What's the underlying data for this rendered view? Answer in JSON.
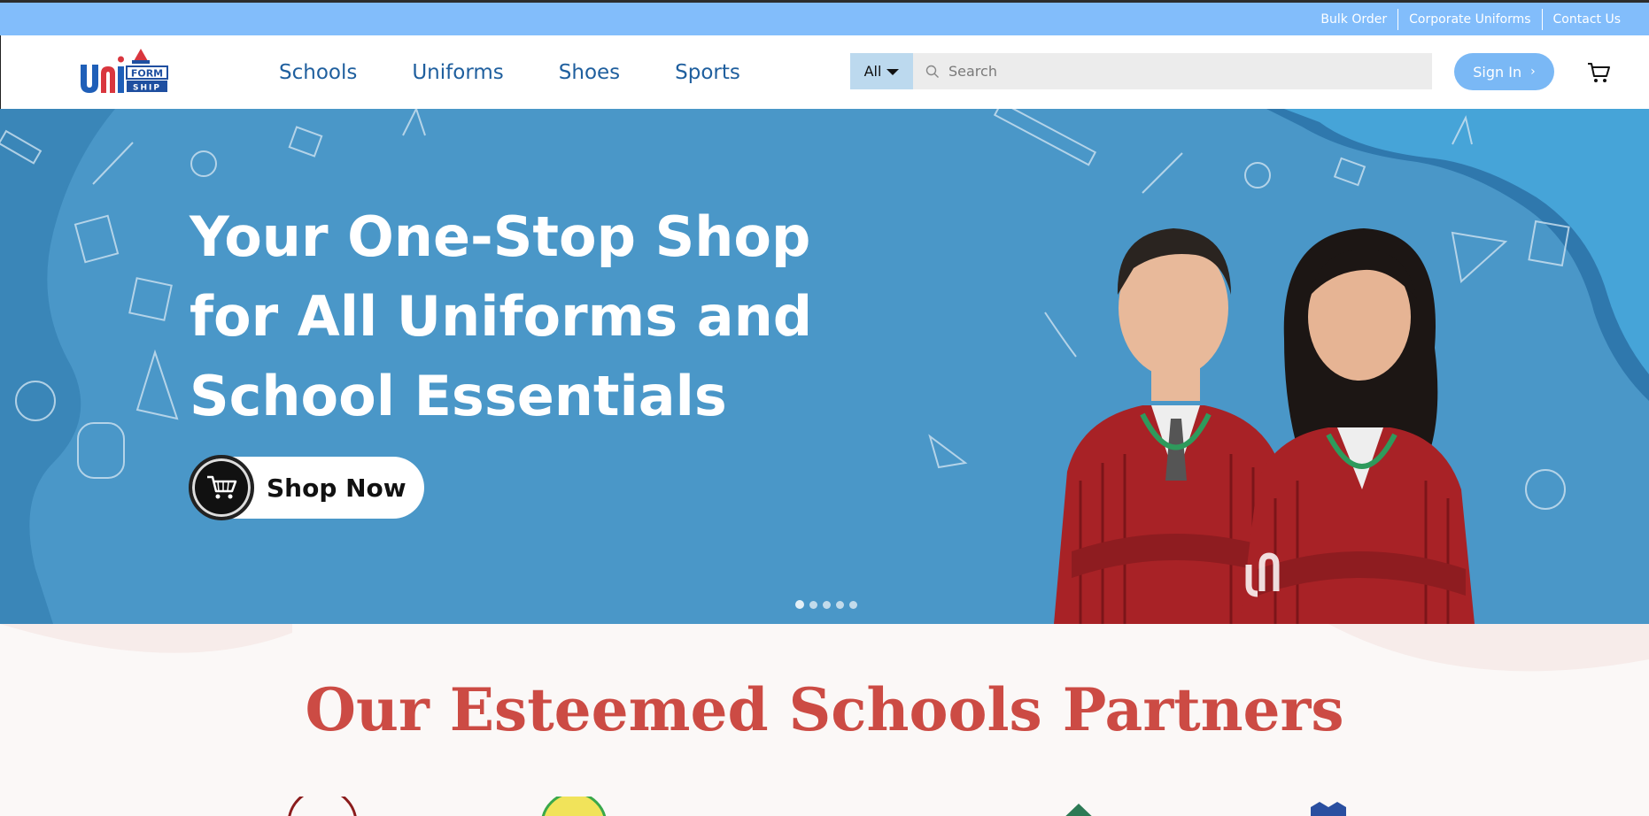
{
  "topbar": {
    "links": [
      "Bulk Order",
      "Corporate Uniforms",
      "Contact Us"
    ]
  },
  "header": {
    "logo_text": "UNIFORM SHIP",
    "nav": [
      "Schools",
      "Uniforms",
      "Shoes",
      "Sports"
    ],
    "search": {
      "category": "All",
      "placeholder": "Search"
    },
    "signin_label": "Sign In",
    "cart_icon": "cart-icon"
  },
  "hero": {
    "headline": [
      "Your One-Stop Shop",
      "for All Uniforms and",
      "School Essentials"
    ],
    "cta_label": "Shop Now",
    "slides": 5,
    "active_slide": 1,
    "background_color": "#4a97c8"
  },
  "partners": {
    "title": "Our Esteemed Schools Partners"
  },
  "colors": {
    "topbar": "#82bdfb",
    "nav_text": "#1f5f9e",
    "signin": "#7ab8f5",
    "partners_title": "#cc4b44"
  }
}
